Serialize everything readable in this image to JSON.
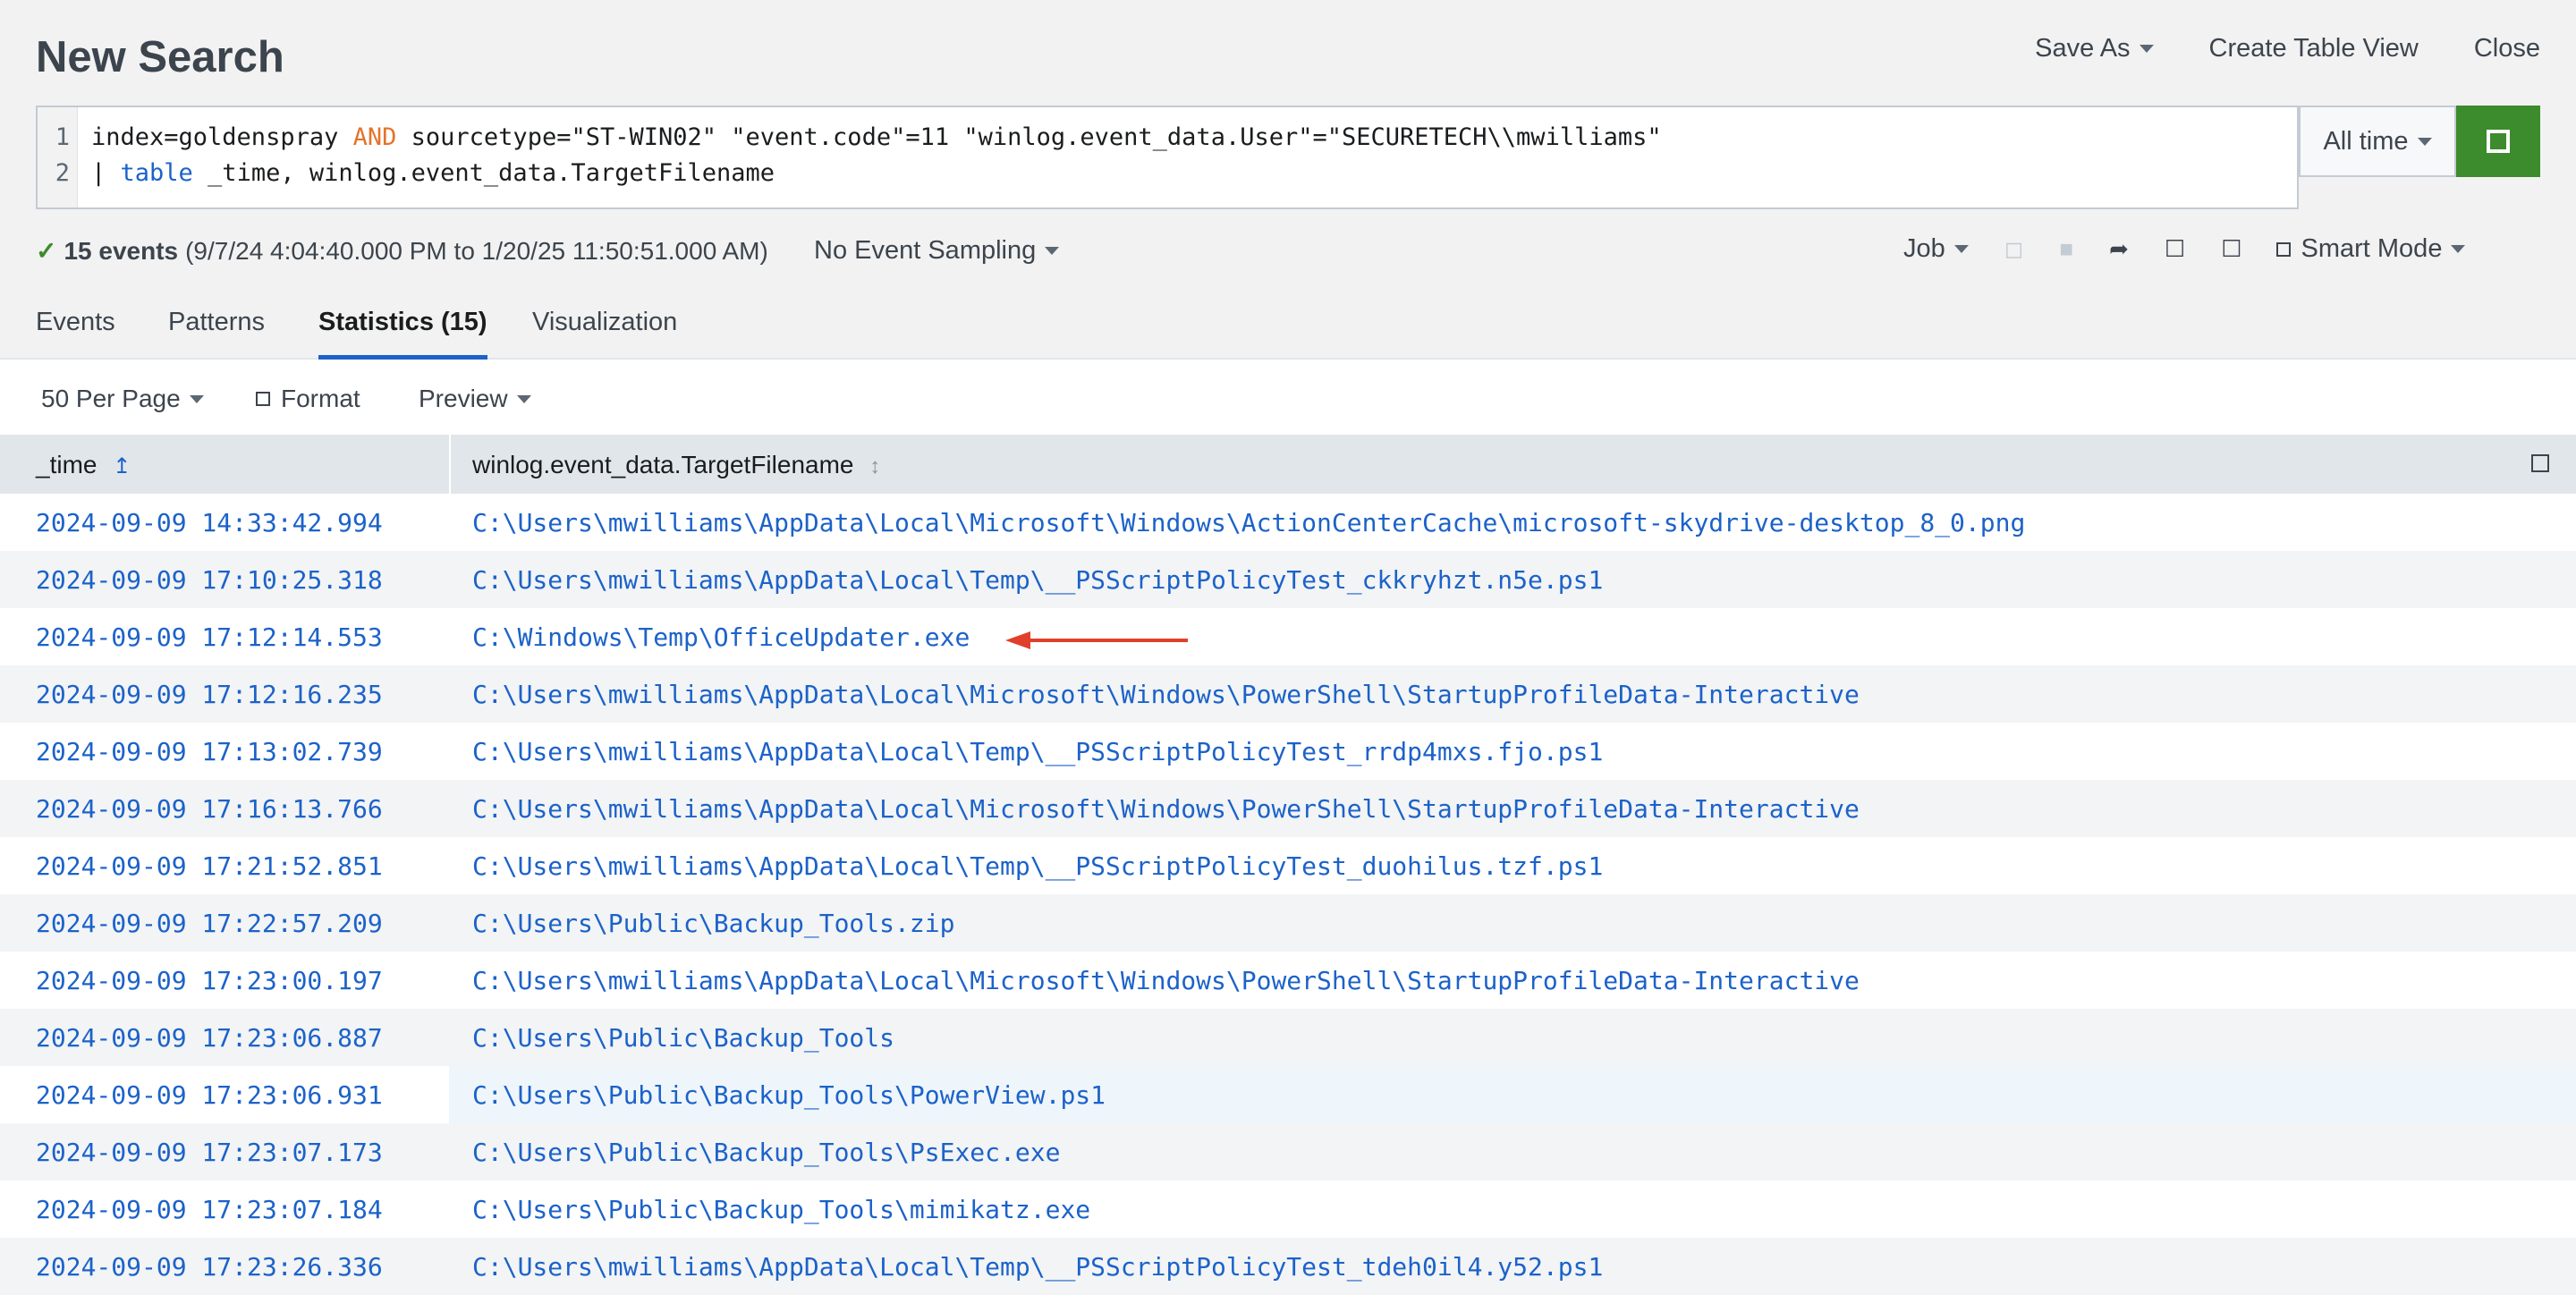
{
  "header": {
    "title": "New Search",
    "actions": {
      "save_as": "Save As",
      "create_table_view": "Create Table View",
      "close": "Close"
    }
  },
  "search": {
    "line_numbers": [
      "1",
      "2"
    ],
    "line1": {
      "part1": "index=goldenspray ",
      "and": "AND",
      "part2": " sourcetype=\"ST-WIN02\" \"event.code\"=11 \"winlog.event_data.User\"=\"SECURETECH\\\\mwilliams\""
    },
    "line2": {
      "pipe": "| ",
      "cmd": "table",
      "rest": " _time, winlog.event_data.TargetFilename"
    },
    "time_range": "All time"
  },
  "status": {
    "count": "15 events",
    "range": "(9/7/24 4:04:40.000 PM to 1/20/25 11:50:51.000 AM)",
    "sampling": "No Event Sampling",
    "job": "Job",
    "mode": "Smart Mode"
  },
  "tabs": [
    "Events",
    "Patterns",
    "Statistics (15)",
    "Visualization"
  ],
  "toolbar": {
    "per_page": "50 Per Page",
    "format": "Format",
    "preview": "Preview"
  },
  "table": {
    "columns": [
      "_time",
      "winlog.event_data.TargetFilename"
    ],
    "rows": [
      {
        "time": "2024-09-09 14:33:42.994",
        "file": "C:\\Users\\mwilliams\\AppData\\Local\\Microsoft\\Windows\\ActionCenterCache\\microsoft-skydrive-desktop_8_0.png"
      },
      {
        "time": "2024-09-09 17:10:25.318",
        "file": "C:\\Users\\mwilliams\\AppData\\Local\\Temp\\__PSScriptPolicyTest_ckkryhzt.n5e.ps1"
      },
      {
        "time": "2024-09-09 17:12:14.553",
        "file": "C:\\Windows\\Temp\\OfficeUpdater.exe"
      },
      {
        "time": "2024-09-09 17:12:16.235",
        "file": "C:\\Users\\mwilliams\\AppData\\Local\\Microsoft\\Windows\\PowerShell\\StartupProfileData-Interactive"
      },
      {
        "time": "2024-09-09 17:13:02.739",
        "file": "C:\\Users\\mwilliams\\AppData\\Local\\Temp\\__PSScriptPolicyTest_rrdp4mxs.fjo.ps1"
      },
      {
        "time": "2024-09-09 17:16:13.766",
        "file": "C:\\Users\\mwilliams\\AppData\\Local\\Microsoft\\Windows\\PowerShell\\StartupProfileData-Interactive"
      },
      {
        "time": "2024-09-09 17:21:52.851",
        "file": "C:\\Users\\mwilliams\\AppData\\Local\\Temp\\__PSScriptPolicyTest_duohilus.tzf.ps1"
      },
      {
        "time": "2024-09-09 17:22:57.209",
        "file": "C:\\Users\\Public\\Backup_Tools.zip"
      },
      {
        "time": "2024-09-09 17:23:00.197",
        "file": "C:\\Users\\mwilliams\\AppData\\Local\\Microsoft\\Windows\\PowerShell\\StartupProfileData-Interactive"
      },
      {
        "time": "2024-09-09 17:23:06.887",
        "file": "C:\\Users\\Public\\Backup_Tools"
      },
      {
        "time": "2024-09-09 17:23:06.931",
        "file": "C:\\Users\\Public\\Backup_Tools\\PowerView.ps1"
      },
      {
        "time": "2024-09-09 17:23:07.173",
        "file": "C:\\Users\\Public\\Backup_Tools\\PsExec.exe"
      },
      {
        "time": "2024-09-09 17:23:07.184",
        "file": "C:\\Users\\Public\\Backup_Tools\\mimikatz.exe"
      },
      {
        "time": "2024-09-09 17:23:26.336",
        "file": "C:\\Users\\mwilliams\\AppData\\Local\\Temp\\__PSScriptPolicyTest_tdeh0il4.y52.ps1"
      }
    ]
  },
  "colors": {
    "accent": "#1c62c9",
    "go_button": "#3c8b2d",
    "keyword_and": "#e4732a",
    "annotation_arrow": "#e0402a"
  },
  "icons": [
    "caret-down-icon",
    "checkmark-icon",
    "pause-icon",
    "stop-icon",
    "share-icon",
    "export-icon",
    "print-icon",
    "sort-icon",
    "column-toggle-icon",
    "arrow-annotation-icon"
  ]
}
